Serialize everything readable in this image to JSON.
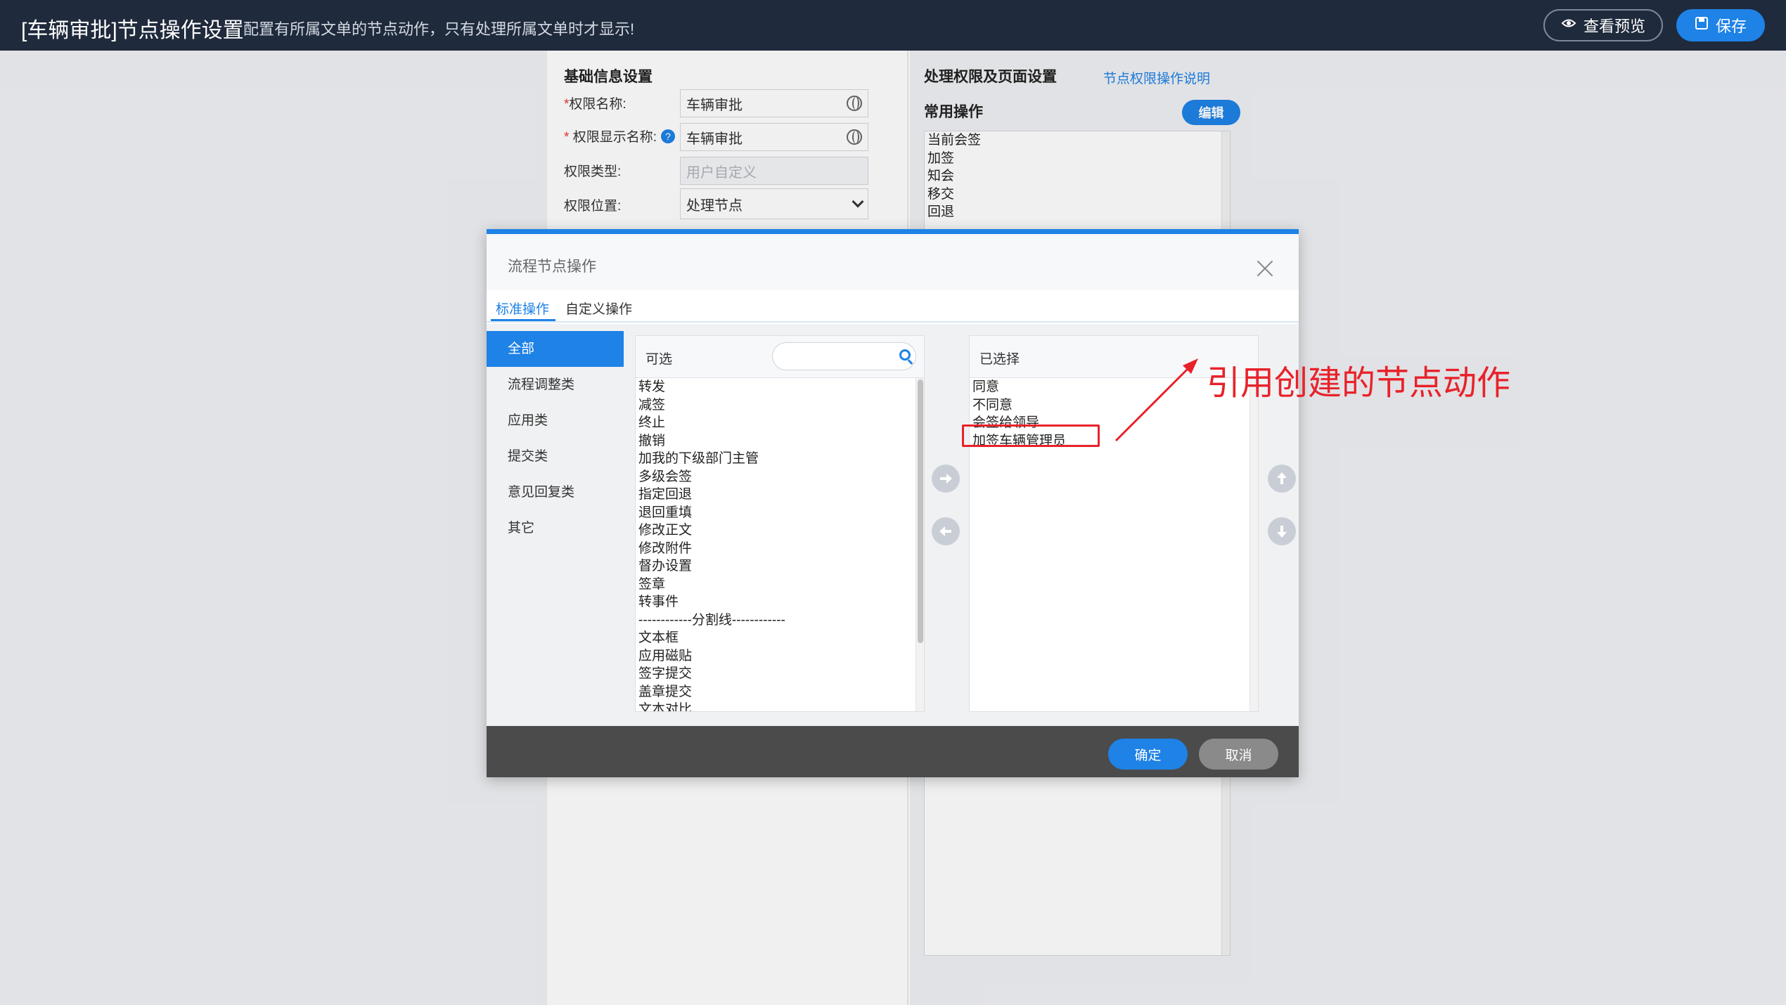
{
  "topbar": {
    "title": "[车辆审批]节点操作设置",
    "description": "配置有所属文单的节点动作，只有处理所属文单时才显示!",
    "preview_label": "查看预览",
    "save_label": "保存"
  },
  "basic_info": {
    "section_title": "基础信息设置",
    "fields": [
      {
        "label": "权限名称:",
        "value": "车辆审批",
        "required": true
      },
      {
        "label": "权限显示名称:",
        "value": "车辆审批",
        "required": true
      },
      {
        "label": "权限类型:",
        "placeholder": "用户自定义"
      },
      {
        "label": "权限位置:",
        "value": "处理节点"
      }
    ]
  },
  "permissions": {
    "section_title": "处理权限及页面设置",
    "help_link": "节点权限操作说明",
    "common_ops_title": "常用操作",
    "edit_label": "编辑",
    "common_ops": [
      "当前会签",
      "加签",
      "知会",
      "移交",
      "回退"
    ]
  },
  "modal": {
    "title": "流程节点操作",
    "tabs": [
      "标准操作",
      "自定义操作"
    ],
    "categories": [
      "全部",
      "流程调整类",
      "应用类",
      "提交类",
      "意见回复类",
      "其它"
    ],
    "available": {
      "label": "可选",
      "search_value": "",
      "items": [
        "转发",
        "减签",
        "终止",
        "撤销",
        "加我的下级部门主管",
        "多级会签",
        "指定回退",
        "退回重填",
        "修改正文",
        "修改附件",
        "督办设置",
        "签章",
        "转事件",
        "------------分割线------------",
        "文本框",
        "应用磁贴",
        "签字提交",
        "盖章提交",
        "文本对比"
      ]
    },
    "selected": {
      "label": "已选择",
      "items": [
        "同意",
        "不同意",
        "会签给领导",
        "加签车辆管理员"
      ]
    },
    "ok_label": "确定",
    "cancel_label": "取消"
  },
  "annotation": {
    "text": "引用创建的节点动作",
    "color": "#e8222a"
  },
  "colors": {
    "topbar": "#1f2a3c",
    "accent": "#1e82e6",
    "footer": "#4b4b4b"
  }
}
